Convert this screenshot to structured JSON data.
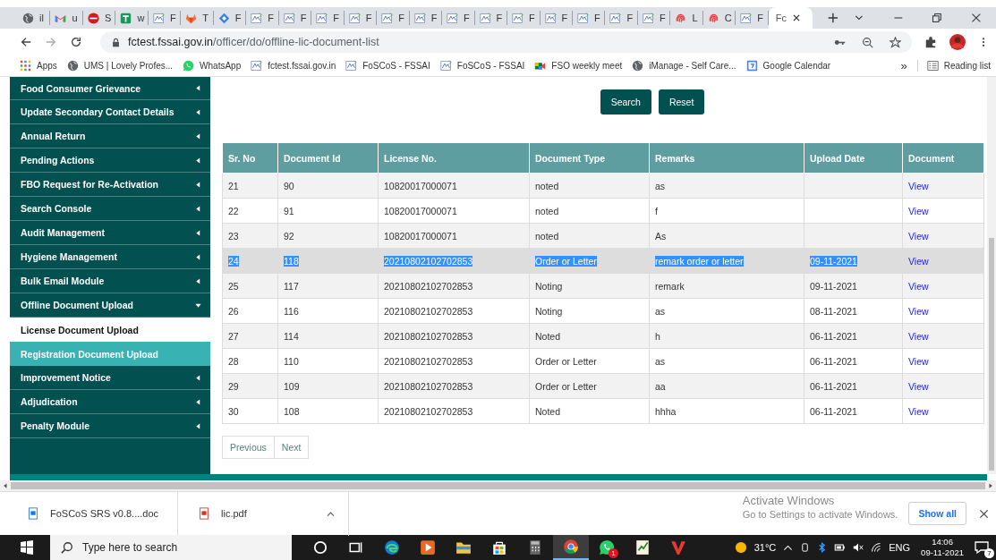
{
  "browser": {
    "tabs": [
      {
        "label": "il",
        "selected": false
      },
      {
        "label": "u",
        "selected": false
      },
      {
        "label": "S",
        "selected": false
      },
      {
        "label": "w",
        "selected": false
      },
      {
        "label": "F",
        "selected": false
      },
      {
        "label": "T",
        "selected": false
      },
      {
        "label": "F",
        "selected": false
      },
      {
        "label": "F",
        "selected": false
      },
      {
        "label": "F",
        "selected": false
      },
      {
        "label": "F",
        "selected": false
      },
      {
        "label": "F",
        "selected": false
      },
      {
        "label": "F",
        "selected": false
      },
      {
        "label": "F",
        "selected": false
      },
      {
        "label": "F",
        "selected": false
      },
      {
        "label": "F",
        "selected": false
      },
      {
        "label": "F",
        "selected": false
      },
      {
        "label": "F",
        "selected": false
      },
      {
        "label": "F",
        "selected": false
      },
      {
        "label": "F",
        "selected": false
      },
      {
        "label": "F",
        "selected": false
      },
      {
        "label": "L",
        "selected": false
      },
      {
        "label": "C",
        "selected": false
      },
      {
        "label": "F",
        "selected": false
      },
      {
        "label": "Fc",
        "selected": true
      }
    ],
    "url": {
      "host": "fctest.fssai.gov.in",
      "path": "/officer/do/offline-lic-document-list"
    },
    "bookmarks": [
      {
        "label": "Apps"
      },
      {
        "label": "UMS | Lovely Profes..."
      },
      {
        "label": "WhatsApp"
      },
      {
        "label": "fctest.fssai.gov.in"
      },
      {
        "label": "FoSCoS - FSSAI"
      },
      {
        "label": "FoSCoS - FSSAI"
      },
      {
        "label": "FSO weekly meet"
      },
      {
        "label": "iManage - Self Care..."
      },
      {
        "label": "Google Calendar"
      }
    ],
    "more": "»",
    "reading_list": "Reading list"
  },
  "sidebar": {
    "items": [
      {
        "label": "Food Consumer Grievance",
        "kind": "menu",
        "expanded": false
      },
      {
        "label": "Update Secondary Contact Details",
        "kind": "menu",
        "expanded": false
      },
      {
        "label": "Annual Return",
        "kind": "menu",
        "expanded": false
      },
      {
        "label": "Pending Actions",
        "kind": "menu",
        "expanded": false
      },
      {
        "label": "FBO Request for Re-Activation",
        "kind": "menu",
        "expanded": false
      },
      {
        "label": "Search Console",
        "kind": "menu",
        "expanded": false
      },
      {
        "label": "Audit Management",
        "kind": "menu",
        "expanded": false
      },
      {
        "label": "Hygiene Management",
        "kind": "menu",
        "expanded": false
      },
      {
        "label": "Bulk Email Module",
        "kind": "menu",
        "expanded": false
      },
      {
        "label": "Offline Document Upload",
        "kind": "menu",
        "expanded": true
      },
      {
        "label": "License Document Upload",
        "kind": "submenu",
        "selected": true
      },
      {
        "label": "Registration Document Upload",
        "kind": "submenu",
        "selected": false
      },
      {
        "label": "Improvement Notice",
        "kind": "menu",
        "expanded": false
      },
      {
        "label": "Adjudication",
        "kind": "menu",
        "expanded": false
      },
      {
        "label": "Penalty Module",
        "kind": "menu",
        "expanded": false
      }
    ]
  },
  "actions": [
    "Search",
    "Reset"
  ],
  "table": {
    "columns": [
      {
        "label": "Sr. No",
        "kind": "text"
      },
      {
        "label": "Document Id",
        "kind": "text"
      },
      {
        "label": "License No.",
        "kind": "text"
      },
      {
        "label": "Document Type",
        "kind": "text"
      },
      {
        "label": "Remarks",
        "kind": "text"
      },
      {
        "label": "Upload Date",
        "kind": "text"
      },
      {
        "label": "Document",
        "kind": "link"
      }
    ],
    "rows": [
      {
        "cells": [
          "21",
          "90",
          "10820017000071",
          "noted",
          "as",
          "",
          "View"
        ],
        "selected": false
      },
      {
        "cells": [
          "22",
          "91",
          "10820017000071",
          "noted",
          "f",
          "",
          "View"
        ],
        "selected": false
      },
      {
        "cells": [
          "23",
          "92",
          "10820017000071",
          "noted",
          "As",
          "",
          "View"
        ],
        "selected": false
      },
      {
        "cells": [
          "24",
          "118",
          "20210802102702853",
          "Order or Letter",
          "remark order or letter",
          "09-11-2021",
          "View"
        ],
        "selected": true
      },
      {
        "cells": [
          "25",
          "117",
          "20210802102702853",
          "Noting",
          "remark",
          "09-11-2021",
          "View"
        ],
        "selected": false
      },
      {
        "cells": [
          "26",
          "116",
          "20210802102702853",
          "Noting",
          "as",
          "08-11-2021",
          "View"
        ],
        "selected": false
      },
      {
        "cells": [
          "27",
          "114",
          "20210802102702853",
          "Noted",
          "h",
          "06-11-2021",
          "View"
        ],
        "selected": false
      },
      {
        "cells": [
          "28",
          "110",
          "20210802102702853",
          "Order or Letter",
          "as",
          "06-11-2021",
          "View"
        ],
        "selected": false
      },
      {
        "cells": [
          "29",
          "109",
          "20210802102702853",
          "Order or Letter",
          "aa",
          "06-11-2021",
          "View"
        ],
        "selected": false
      },
      {
        "cells": [
          "30",
          "108",
          "20210802102702853",
          "Noted",
          "hhha",
          "06-11-2021",
          "View"
        ],
        "selected": false
      }
    ]
  },
  "pagination": [
    "Previous",
    "Next"
  ],
  "downloads": {
    "items": [
      {
        "name": "FoSCoS SRS v0.8....doc"
      },
      {
        "name": "lic.pdf"
      }
    ],
    "show_all": "Show all"
  },
  "activation": {
    "title": "Activate Windows",
    "text": "Go to Settings to activate Windows."
  },
  "taskbar": {
    "search": {
      "placeholder": "Type here to search"
    },
    "apps": [
      {
        "active": false
      },
      {
        "active": false
      },
      {
        "active": false
      },
      {
        "active": false
      },
      {
        "active": false
      },
      {
        "active": false
      },
      {
        "active": false
      },
      {
        "active": true
      },
      {
        "active": false,
        "badge": "1"
      },
      {
        "active": false
      },
      {
        "active": false
      }
    ],
    "weather": "31°C",
    "language": "ENG",
    "time": "14:06",
    "date": "09-11-2021",
    "notifications": "7"
  }
}
